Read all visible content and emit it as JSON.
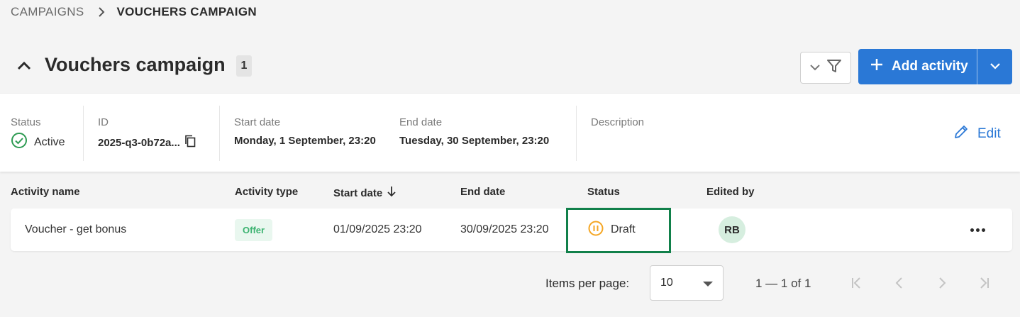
{
  "breadcrumb": {
    "parent": "CAMPAIGNS",
    "current": "VOUCHERS CAMPAIGN"
  },
  "header": {
    "title": "Vouchers campaign",
    "count": "1",
    "add_label": "Add activity"
  },
  "details": {
    "status_label": "Status",
    "status_value": "Active",
    "id_label": "ID",
    "id_value": "2025-q3-0b72a...",
    "start_label": "Start date",
    "start_value": "Monday, 1 September, 23:20",
    "end_label": "End date",
    "end_value": "Tuesday, 30 September, 23:20",
    "description_label": "Description",
    "edit_label": "Edit"
  },
  "table": {
    "columns": [
      "Activity name",
      "Activity type",
      "Start date",
      "End date",
      "Status",
      "Edited by"
    ],
    "rows": [
      {
        "name": "Voucher - get bonus",
        "type": "Offer",
        "start": "01/09/2025 23:20",
        "end": "30/09/2025 23:20",
        "status": "Draft",
        "edited_by": "RB"
      }
    ]
  },
  "pagination": {
    "items_per_page_label": "Items per page:",
    "items_per_page": "10",
    "range": "1 — 1 of 1"
  },
  "icons": {
    "breadcrumb_sep": "chevron-right-icon",
    "collapse": "chevron-up-icon",
    "filter": "filter-icon",
    "add": "plus-icon",
    "status_active": "check-circle-icon",
    "copy": "copy-icon",
    "edit": "pencil-icon",
    "sort": "arrow-down-icon",
    "status_draft": "pause-circle-icon",
    "more": "more-horizontal-icon"
  },
  "colors": {
    "primary": "#2a78d6",
    "active": "#2e9b53",
    "draft": "#f5a623",
    "offer_text": "#3cb371",
    "highlight": "#11804a"
  }
}
